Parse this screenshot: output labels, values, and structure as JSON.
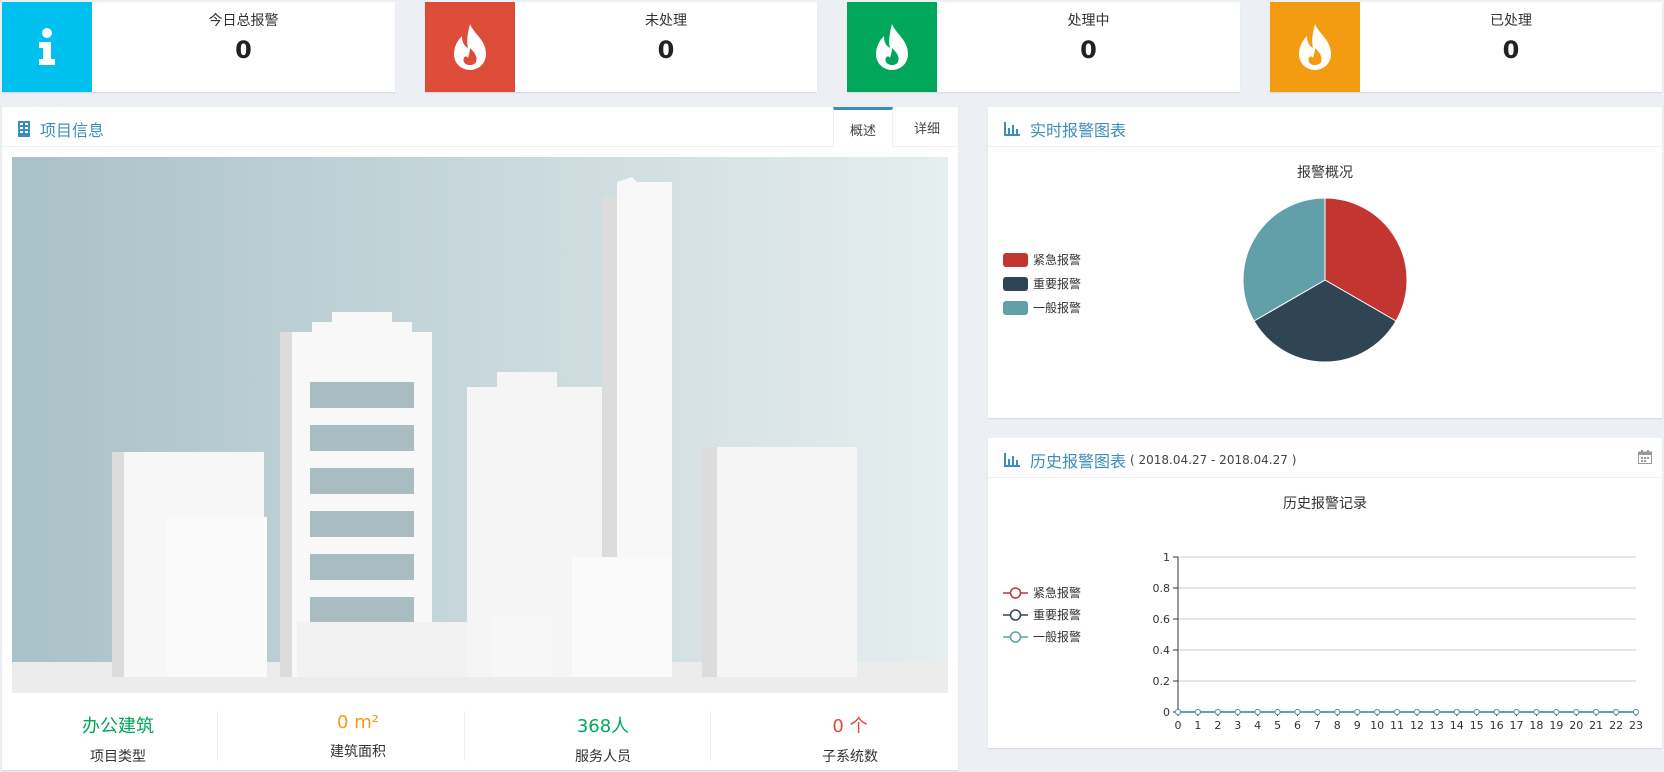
{
  "cards": [
    {
      "label": "今日总报警",
      "value": "0",
      "color": "#00c0ef",
      "icon": "info-icon"
    },
    {
      "label": "未处理",
      "value": "0",
      "color": "#dd4b39",
      "icon": "fire-icon"
    },
    {
      "label": "处理中",
      "value": "0",
      "color": "#00a65a",
      "icon": "fire-icon"
    },
    {
      "label": "已处理",
      "value": "0",
      "color": "#f39c12",
      "icon": "fire-icon"
    }
  ],
  "project": {
    "title": "项目信息",
    "tabs": [
      "概述",
      "详细"
    ],
    "active_tab": "概述",
    "stats": [
      {
        "value": "办公建筑",
        "label": "项目类型",
        "color": "#00a65a"
      },
      {
        "value": "0 m²",
        "label": "建筑面积",
        "color": "#f39c12"
      },
      {
        "value": "368人",
        "label": "服务人员",
        "color": "#00a65a"
      },
      {
        "value": "0 个",
        "label": "子系统数",
        "color": "#dd4b39"
      }
    ]
  },
  "realtime": {
    "title": "实时报警图表",
    "chart_title": "报警概况",
    "legend": [
      "紧急报警",
      "重要报警",
      "一般报警"
    ]
  },
  "history": {
    "title": "历史报警图表",
    "date_range": "( 2018.04.27 - 2018.04.27 )",
    "chart_title": "历史报警记录",
    "legend": [
      "紧急报警",
      "重要报警",
      "一般报警"
    ]
  },
  "colors": {
    "emergency": "#c23531",
    "important": "#2f4554",
    "general": "#61a0a8",
    "accent": "#3c8dbc"
  },
  "chart_data": [
    {
      "type": "pie",
      "title": "报警概况",
      "categories": [
        "紧急报警",
        "重要报警",
        "一般报警"
      ],
      "values": [
        1,
        1,
        1
      ]
    },
    {
      "type": "line",
      "title": "历史报警记录",
      "x": [
        0,
        1,
        2,
        3,
        4,
        5,
        6,
        7,
        8,
        9,
        10,
        11,
        12,
        13,
        14,
        15,
        16,
        17,
        18,
        19,
        20,
        21,
        22,
        23
      ],
      "ylim": [
        0,
        1
      ],
      "yticks": [
        0,
        0.2,
        0.4,
        0.6,
        0.8,
        1
      ],
      "series": [
        {
          "name": "紧急报警",
          "values": [
            0,
            0,
            0,
            0,
            0,
            0,
            0,
            0,
            0,
            0,
            0,
            0,
            0,
            0,
            0,
            0,
            0,
            0,
            0,
            0,
            0,
            0,
            0,
            0
          ]
        },
        {
          "name": "重要报警",
          "values": [
            0,
            0,
            0,
            0,
            0,
            0,
            0,
            0,
            0,
            0,
            0,
            0,
            0,
            0,
            0,
            0,
            0,
            0,
            0,
            0,
            0,
            0,
            0,
            0
          ]
        },
        {
          "name": "一般报警",
          "values": [
            0,
            0,
            0,
            0,
            0,
            0,
            0,
            0,
            0,
            0,
            0,
            0,
            0,
            0,
            0,
            0,
            0,
            0,
            0,
            0,
            0,
            0,
            0,
            0
          ]
        }
      ]
    }
  ]
}
